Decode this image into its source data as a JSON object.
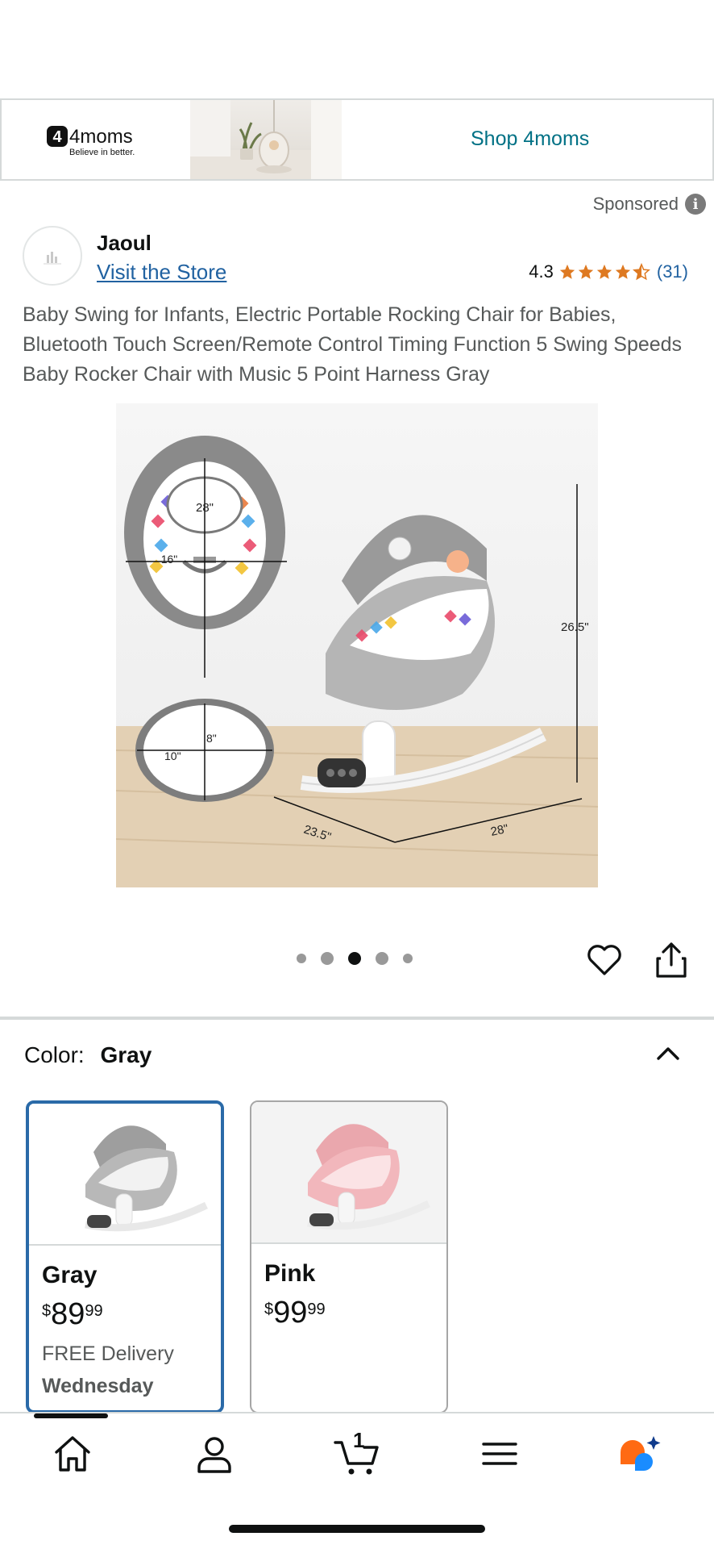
{
  "banner": {
    "brand": "4moms",
    "tagline": "Believe in better.",
    "cta": "Shop 4moms"
  },
  "sponsored_label": "Sponsored",
  "store": {
    "name": "Jaoul",
    "link": "Visit the Store"
  },
  "rating": {
    "value": "4.3",
    "count": "(31)",
    "stars": 4.3
  },
  "product": {
    "title": "Baby Swing for Infants, Electric Portable Rocking Chair for Babies, Bluetooth Touch Screen/Remote Control Timing Function 5 Swing Speeds Baby Rocker Chair with Music 5 Point Harness Gray",
    "dimension_labels": [
      "28\"",
      "16\"",
      "8\"",
      "10\"",
      "26.5\"",
      "23.5\"",
      "28\""
    ]
  },
  "carousel": {
    "total": 5,
    "active_index": 2
  },
  "color": {
    "label": "Color:",
    "selected": "Gray",
    "options": [
      {
        "name": "Gray",
        "symbol": "$",
        "whole": "89",
        "fraction": "99",
        "delivery_line1": "FREE Delivery",
        "delivery_line2": "Wednesday",
        "tint": "#9e9e9e"
      },
      {
        "name": "Pink",
        "symbol": "$",
        "whole": "99",
        "fraction": "99",
        "delivery_line1": "",
        "delivery_line2": "",
        "tint": "#efb3b8"
      }
    ]
  },
  "nav": {
    "cart_count": "1",
    "items": [
      "home-icon",
      "account-icon",
      "cart-icon",
      "menu-icon",
      "rufus-icon"
    ]
  },
  "colors": {
    "link": "#2162a1",
    "cta": "#007185",
    "star": "#de7921",
    "selected_border": "#2a6aa8"
  }
}
